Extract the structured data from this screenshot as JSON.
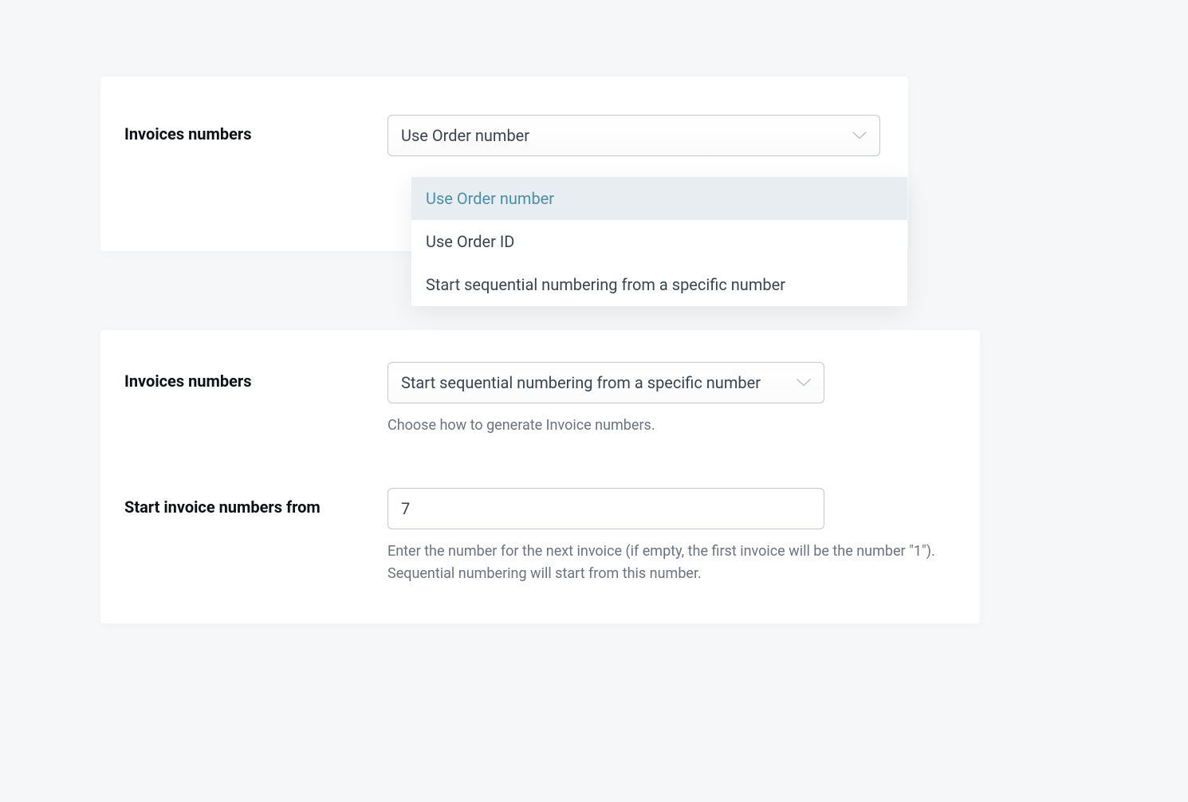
{
  "top_panel": {
    "label": "Invoices numbers",
    "select_value": "Use Order number",
    "options": [
      "Use Order number",
      "Use Order ID",
      "Start sequential numbering from a specific number"
    ]
  },
  "bottom_panel": {
    "field1": {
      "label": "Invoices numbers",
      "select_value": "Start sequential numbering from a specific number",
      "help": "Choose how to generate Invoice numbers."
    },
    "field2": {
      "label": "Start invoice numbers from",
      "value": "7",
      "help": "Enter the number for the next invoice (if empty, the first invoice will be the number \"1\"). Sequential numbering will start from this number."
    }
  }
}
